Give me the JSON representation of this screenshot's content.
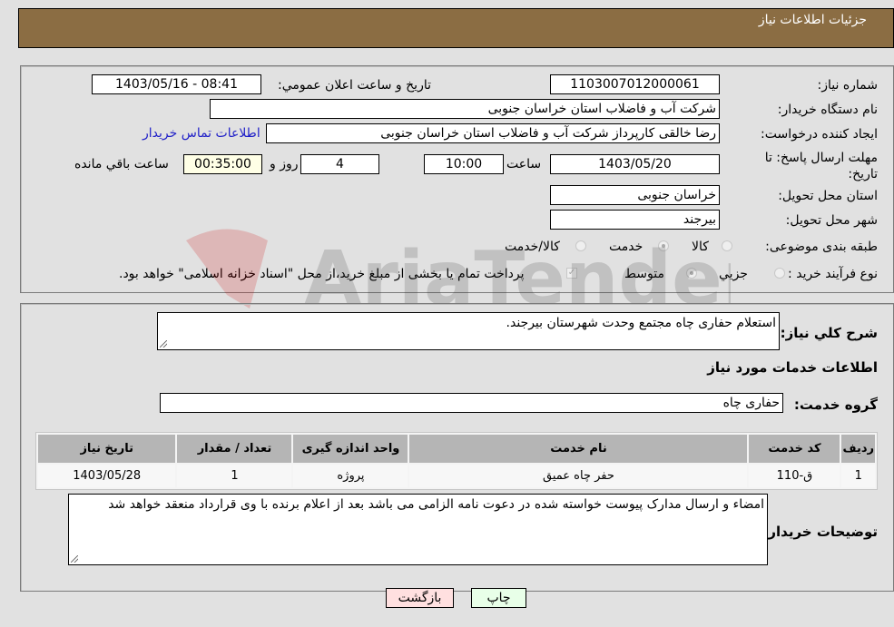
{
  "header": {
    "title": "جزئیات اطلاعات نیاز"
  },
  "details": {
    "need_number_label": "شماره نیاز:",
    "need_number": "1103007012000061",
    "announce_label": "تاریخ و ساعت اعلان عمومي:",
    "announce_value": "1403/05/16 - 08:41",
    "buyer_org_label": "نام دستگاه خریدار:",
    "buyer_org": "شرکت آب و فاضلاب استان خراسان جنوبی",
    "creator_label": "ایجاد کننده درخواست:",
    "creator": "رضا خالقی کارپرداز شرکت آب و فاضلاب استان خراسان جنوبی",
    "contact_link": "اطلاعات تماس خریدار",
    "deadline_label": "مهلت ارسال پاسخ: تا تاریخ:",
    "deadline_date": "1403/05/20",
    "time_label": "ساعت",
    "deadline_time": "10:00",
    "days_value": "4",
    "days_label": "روز و",
    "remaining_time": "00:35:00",
    "remaining_label": "ساعت باقي مانده",
    "province_label": "استان محل تحویل:",
    "province": "خراسان جنوبی",
    "city_label": "شهر محل تحویل:",
    "city": "بیرجند",
    "category_label": "طبقه بندی موضوعی:",
    "category_options": [
      {
        "label": "کالا",
        "checked": false
      },
      {
        "label": "خدمت",
        "checked": true
      },
      {
        "label": "کالا/خدمت",
        "checked": false
      }
    ],
    "process_label": "نوع فرآیند خرید :",
    "process_options": [
      {
        "label": "جزيي",
        "checked": false
      },
      {
        "label": "متوسط",
        "checked": true
      }
    ],
    "treasury_checkbox_label": "پرداخت تمام یا بخشی از مبلغ خرید،از محل \"اسناد خزانه اسلامی\" خواهد بود.",
    "treasury_checked": true
  },
  "summary": {
    "description_label": "شرح کلي نیاز:",
    "description": "استعلام حفاری چاه مجتمع وحدت شهرستان بیرجند.",
    "services_heading": "اطلاعات خدمات مورد نیاز",
    "service_group_label": "گروه خدمت:",
    "service_group": "حفاری چاه"
  },
  "table": {
    "headers": [
      "ردیف",
      "کد خدمت",
      "نام خدمت",
      "واحد اندازه گیری",
      "تعداد / مقدار",
      "تاریخ نیاز"
    ],
    "rows": [
      [
        "1",
        "ق-110",
        "حفر چاه عمیق",
        "پروژه",
        "1",
        "1403/05/28"
      ]
    ]
  },
  "buyer_notes": {
    "label": "توضیحات خریدار:",
    "text": "امضاء و ارسال مدارک پیوست خواسته شده در دعوت نامه الزامی می باشد بعد از اعلام برنده با وی قرارداد منعقد خواهد شد"
  },
  "buttons": {
    "print": "چاپ",
    "back": "بازگشت"
  },
  "watermark": {
    "text": "AriaTender.neT"
  }
}
